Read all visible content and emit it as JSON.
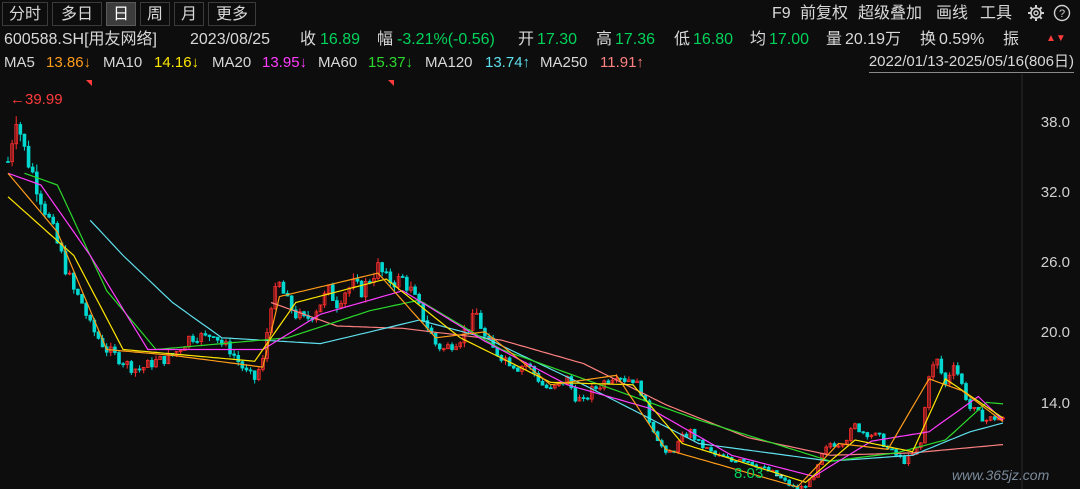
{
  "toolbar": {
    "periods": [
      "分时",
      "多日",
      "日",
      "周",
      "月",
      "更多"
    ],
    "active_period": "日",
    "f9": "F9",
    "adjust": "前复权",
    "overlay": "超级叠加",
    "draw": "画线",
    "tools": "工具"
  },
  "info": {
    "code": "600588.SH[用友网络]",
    "date": "2023/08/25",
    "close_label": "收",
    "close": "16.89",
    "change_label": "幅",
    "change": "-3.21%(-0.56)",
    "open_label": "开",
    "open": "17.30",
    "high_label": "高",
    "high": "17.36",
    "low_label": "低",
    "low": "16.80",
    "avg_label": "均",
    "avg": "17.00",
    "volume_label": "量",
    "volume": "20.19万",
    "turnover_label": "换",
    "turnover": "0.59%",
    "amplitude_label": "振"
  },
  "ma": {
    "ma5_label": "MA5",
    "ma5": "13.86↓",
    "ma10_label": "MA10",
    "ma10": "14.16↓",
    "ma20_label": "MA20",
    "ma20": "13.95↓",
    "ma60_label": "MA60",
    "ma60": "15.37↓",
    "ma120_label": "MA120",
    "ma120": "13.74↑",
    "ma250_label": "MA250",
    "ma250": "11.91↑"
  },
  "range": "2022/01/13-2025/05/16(806日)",
  "annotations": {
    "high": "←39.99",
    "low": "8.03"
  },
  "watermark": "www.365jz.com",
  "colors": {
    "up": "#ff3b3b",
    "down": "#00d35a",
    "candle_up": "#ff2e2e",
    "candle_down": "#00d8d0",
    "ma5": "#ff9c1a",
    "ma10": "#ffe600",
    "ma20": "#ff3cff",
    "ma60": "#2bd92b",
    "ma120": "#5fe0ee",
    "ma250": "#ff8080",
    "text": "#d8d8d8"
  },
  "chart_data": {
    "type": "candlestick",
    "y_ticks": [
      "38.0",
      "32.0",
      "26.0",
      "20.0",
      "14.0"
    ],
    "ylim": [
      8,
      40
    ],
    "x_range": [
      "2022/01/13",
      "2025/05/16"
    ],
    "price_path": [
      [
        0,
        36
      ],
      [
        1,
        39.99
      ],
      [
        2,
        37
      ],
      [
        3,
        35
      ],
      [
        4,
        33
      ],
      [
        5,
        31
      ],
      [
        6,
        29
      ],
      [
        7,
        27
      ],
      [
        8,
        25
      ],
      [
        9,
        24
      ],
      [
        10,
        22
      ],
      [
        11,
        21
      ],
      [
        12,
        20
      ],
      [
        13,
        19.5
      ],
      [
        14,
        19
      ],
      [
        15,
        18.5
      ],
      [
        16,
        18.3
      ],
      [
        17,
        18.7
      ],
      [
        18,
        19
      ],
      [
        19,
        19.2
      ],
      [
        20,
        19.5
      ],
      [
        21,
        20.2
      ],
      [
        22,
        21
      ],
      [
        23,
        21.2
      ],
      [
        24,
        21
      ],
      [
        25,
        21.5
      ],
      [
        26,
        20.5
      ],
      [
        27,
        20
      ],
      [
        28,
        19
      ],
      [
        29,
        18
      ],
      [
        30,
        17.5
      ],
      [
        31,
        19
      ],
      [
        32,
        24
      ],
      [
        33,
        25.5
      ],
      [
        34,
        24
      ],
      [
        35,
        23
      ],
      [
        36,
        22.5
      ],
      [
        37,
        23
      ],
      [
        38,
        24
      ],
      [
        39,
        25
      ],
      [
        40,
        24
      ],
      [
        41,
        25
      ],
      [
        42,
        25.5
      ],
      [
        43,
        25
      ],
      [
        44,
        26
      ],
      [
        45,
        27
      ],
      [
        46,
        26
      ],
      [
        47,
        25.8
      ],
      [
        48,
        26
      ],
      [
        49,
        25
      ],
      [
        50,
        23.5
      ],
      [
        51,
        22
      ],
      [
        52,
        20.5
      ],
      [
        53,
        20
      ],
      [
        54,
        20.5
      ],
      [
        55,
        21
      ],
      [
        56,
        22
      ],
      [
        57,
        23
      ],
      [
        58,
        21
      ],
      [
        59,
        20
      ],
      [
        60,
        19.5
      ],
      [
        61,
        19
      ],
      [
        62,
        18.5
      ],
      [
        63,
        18.8
      ],
      [
        64,
        18
      ],
      [
        65,
        17
      ],
      [
        66,
        16.5
      ],
      [
        67,
        17
      ],
      [
        68,
        17.5
      ],
      [
        69,
        16
      ],
      [
        70,
        15.5
      ],
      [
        71,
        16.5
      ],
      [
        72,
        17
      ],
      [
        73,
        17.5
      ],
      [
        74,
        18
      ],
      [
        75,
        17.5
      ],
      [
        76,
        17.5
      ],
      [
        77,
        16.5
      ],
      [
        78,
        14
      ],
      [
        79,
        12.5
      ],
      [
        80,
        11
      ],
      [
        81,
        11.5
      ],
      [
        82,
        12.5
      ],
      [
        83,
        13
      ],
      [
        84,
        12
      ],
      [
        85,
        11.5
      ],
      [
        86,
        11
      ],
      [
        87,
        10.8
      ],
      [
        88,
        10.5
      ],
      [
        89,
        10.8
      ],
      [
        90,
        10.5
      ],
      [
        91,
        10.2
      ],
      [
        92,
        9.8
      ],
      [
        93,
        9.5
      ],
      [
        94,
        9
      ],
      [
        95,
        8.5
      ],
      [
        96,
        8.03
      ],
      [
        97,
        8.5
      ],
      [
        98,
        9
      ],
      [
        99,
        11
      ],
      [
        100,
        12
      ],
      [
        101,
        12
      ],
      [
        102,
        12.5
      ],
      [
        103,
        13.5
      ],
      [
        104,
        13
      ],
      [
        105,
        12.8
      ],
      [
        106,
        12.5
      ],
      [
        107,
        11.5
      ],
      [
        108,
        11
      ],
      [
        109,
        10.5
      ],
      [
        110,
        11
      ],
      [
        111,
        12
      ],
      [
        112,
        18
      ],
      [
        113,
        19
      ],
      [
        114,
        17
      ],
      [
        115,
        19
      ],
      [
        116,
        17
      ],
      [
        117,
        15
      ],
      [
        118,
        14.5
      ],
      [
        119,
        14
      ],
      [
        120,
        14.2
      ],
      [
        121,
        14
      ]
    ],
    "ma": {
      "MA5": [
        [
          0,
          35
        ],
        [
          6,
          30
        ],
        [
          12,
          20
        ],
        [
          20,
          19.5
        ],
        [
          31,
          18.5
        ],
        [
          33,
          24.5
        ],
        [
          45,
          26.5
        ],
        [
          52,
          21
        ],
        [
          58,
          21.5
        ],
        [
          66,
          17
        ],
        [
          74,
          17.8
        ],
        [
          80,
          11.5
        ],
        [
          96,
          8.3
        ],
        [
          101,
          12
        ],
        [
          107,
          11.5
        ],
        [
          112,
          17.5
        ],
        [
          116,
          16.5
        ],
        [
          121,
          13.86
        ]
      ],
      "MA10": [
        [
          0,
          33
        ],
        [
          8,
          28
        ],
        [
          14,
          20
        ],
        [
          30,
          19
        ],
        [
          35,
          24
        ],
        [
          46,
          26
        ],
        [
          55,
          21
        ],
        [
          66,
          17.2
        ],
        [
          76,
          17
        ],
        [
          82,
          12
        ],
        [
          97,
          8.7
        ],
        [
          103,
          12.3
        ],
        [
          110,
          11.3
        ],
        [
          114,
          17.5
        ],
        [
          121,
          14.16
        ]
      ],
      "MA20": [
        [
          0,
          35
        ],
        [
          4,
          34
        ],
        [
          10,
          28
        ],
        [
          17,
          20
        ],
        [
          31,
          20
        ],
        [
          38,
          23
        ],
        [
          48,
          25
        ],
        [
          58,
          20.7
        ],
        [
          68,
          17
        ],
        [
          78,
          15
        ],
        [
          88,
          11
        ],
        [
          98,
          9.2
        ],
        [
          105,
          12.2
        ],
        [
          112,
          13
        ],
        [
          118,
          16
        ],
        [
          121,
          13.95
        ]
      ],
      "MA60": [
        [
          2,
          35
        ],
        [
          6,
          34
        ],
        [
          12,
          25
        ],
        [
          18,
          20
        ],
        [
          26,
          20.5
        ],
        [
          34,
          21
        ],
        [
          44,
          23.3
        ],
        [
          50,
          24.2
        ],
        [
          60,
          20
        ],
        [
          70,
          17.5
        ],
        [
          84,
          14
        ],
        [
          100,
          10.5
        ],
        [
          108,
          11.2
        ],
        [
          114,
          12.3
        ],
        [
          119,
          15.5
        ],
        [
          121,
          15.37
        ]
      ],
      "MA120": [
        [
          10,
          31
        ],
        [
          14,
          28
        ],
        [
          20,
          24
        ],
        [
          26,
          21
        ],
        [
          38,
          20.5
        ],
        [
          50,
          22.5
        ],
        [
          58,
          21
        ],
        [
          70,
          17
        ],
        [
          84,
          12
        ],
        [
          100,
          10.5
        ],
        [
          110,
          11
        ],
        [
          117,
          13
        ],
        [
          121,
          13.74
        ]
      ],
      "MA250": [
        [
          32,
          24
        ],
        [
          40,
          22
        ],
        [
          48,
          21.8
        ],
        [
          60,
          20.8
        ],
        [
          70,
          18.8
        ],
        [
          80,
          15.3
        ],
        [
          90,
          12.5
        ],
        [
          100,
          11
        ],
        [
          110,
          11.2
        ],
        [
          121,
          11.91
        ]
      ]
    }
  }
}
